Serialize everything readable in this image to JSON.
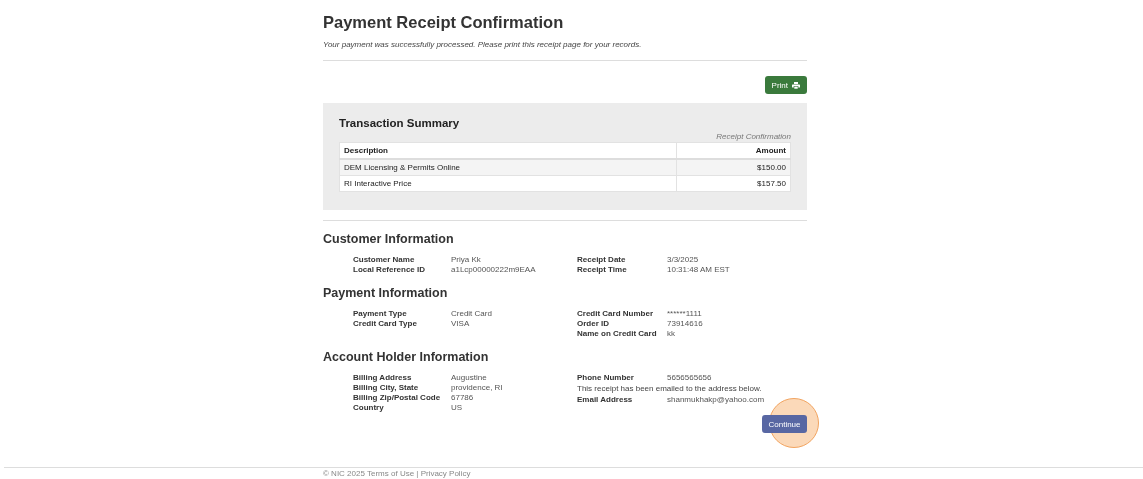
{
  "title": "Payment Receipt Confirmation",
  "subtitle": "Your payment was successfully processed. Please print this receipt page for your records.",
  "print_button": "Print",
  "transaction_summary": {
    "title": "Transaction Summary",
    "caption": "Receipt Confirmation",
    "columns": [
      "Description",
      "Amount"
    ],
    "rows": [
      {
        "description": "DEM Licensing & Permits Online",
        "amount": "$150.00"
      },
      {
        "description": "RI Interactive Price",
        "amount": "$157.50"
      }
    ]
  },
  "sections": [
    {
      "title": "Customer Information",
      "left": [
        {
          "label": "Customer Name",
          "value": "Priya Kk"
        },
        {
          "label": "Local Reference ID",
          "value": "a1Lcp00000222m9EAA"
        }
      ],
      "right": [
        {
          "kind": "pair",
          "label": "Receipt Date",
          "value": "3/3/2025"
        },
        {
          "kind": "pair",
          "label": "Receipt Time",
          "value": "10:31:48 AM EST"
        }
      ]
    },
    {
      "title": "Payment Information",
      "left": [
        {
          "label": "Payment Type",
          "value": "Credit Card"
        },
        {
          "label": "Credit Card Type",
          "value": "VISA"
        }
      ],
      "right": [
        {
          "kind": "pair",
          "label": "Credit Card Number",
          "value": "******1111"
        },
        {
          "kind": "pair",
          "label": "Order ID",
          "value": "73914616"
        },
        {
          "kind": "pair",
          "label": "Name on Credit Card",
          "value": "kk"
        }
      ]
    },
    {
      "title": "Account Holder Information",
      "left": [
        {
          "label": "Billing Address",
          "value": "Augustine"
        },
        {
          "label": "Billing City, State",
          "value": "providence, RI"
        },
        {
          "label": "Billing Zip/Postal Code",
          "value": "67786"
        },
        {
          "label": "Country",
          "value": "US"
        }
      ],
      "right": [
        {
          "kind": "pair",
          "label": "Phone Number",
          "value": "5656565656"
        },
        {
          "kind": "note",
          "text": "This receipt has been emailed to the address below."
        },
        {
          "kind": "pair",
          "label": "Email Address",
          "value": "shanmukhakp@yahoo.com"
        }
      ]
    }
  ],
  "continue_button": "Continue",
  "footer": "© NIC 2025 Terms of Use | Privacy Policy"
}
